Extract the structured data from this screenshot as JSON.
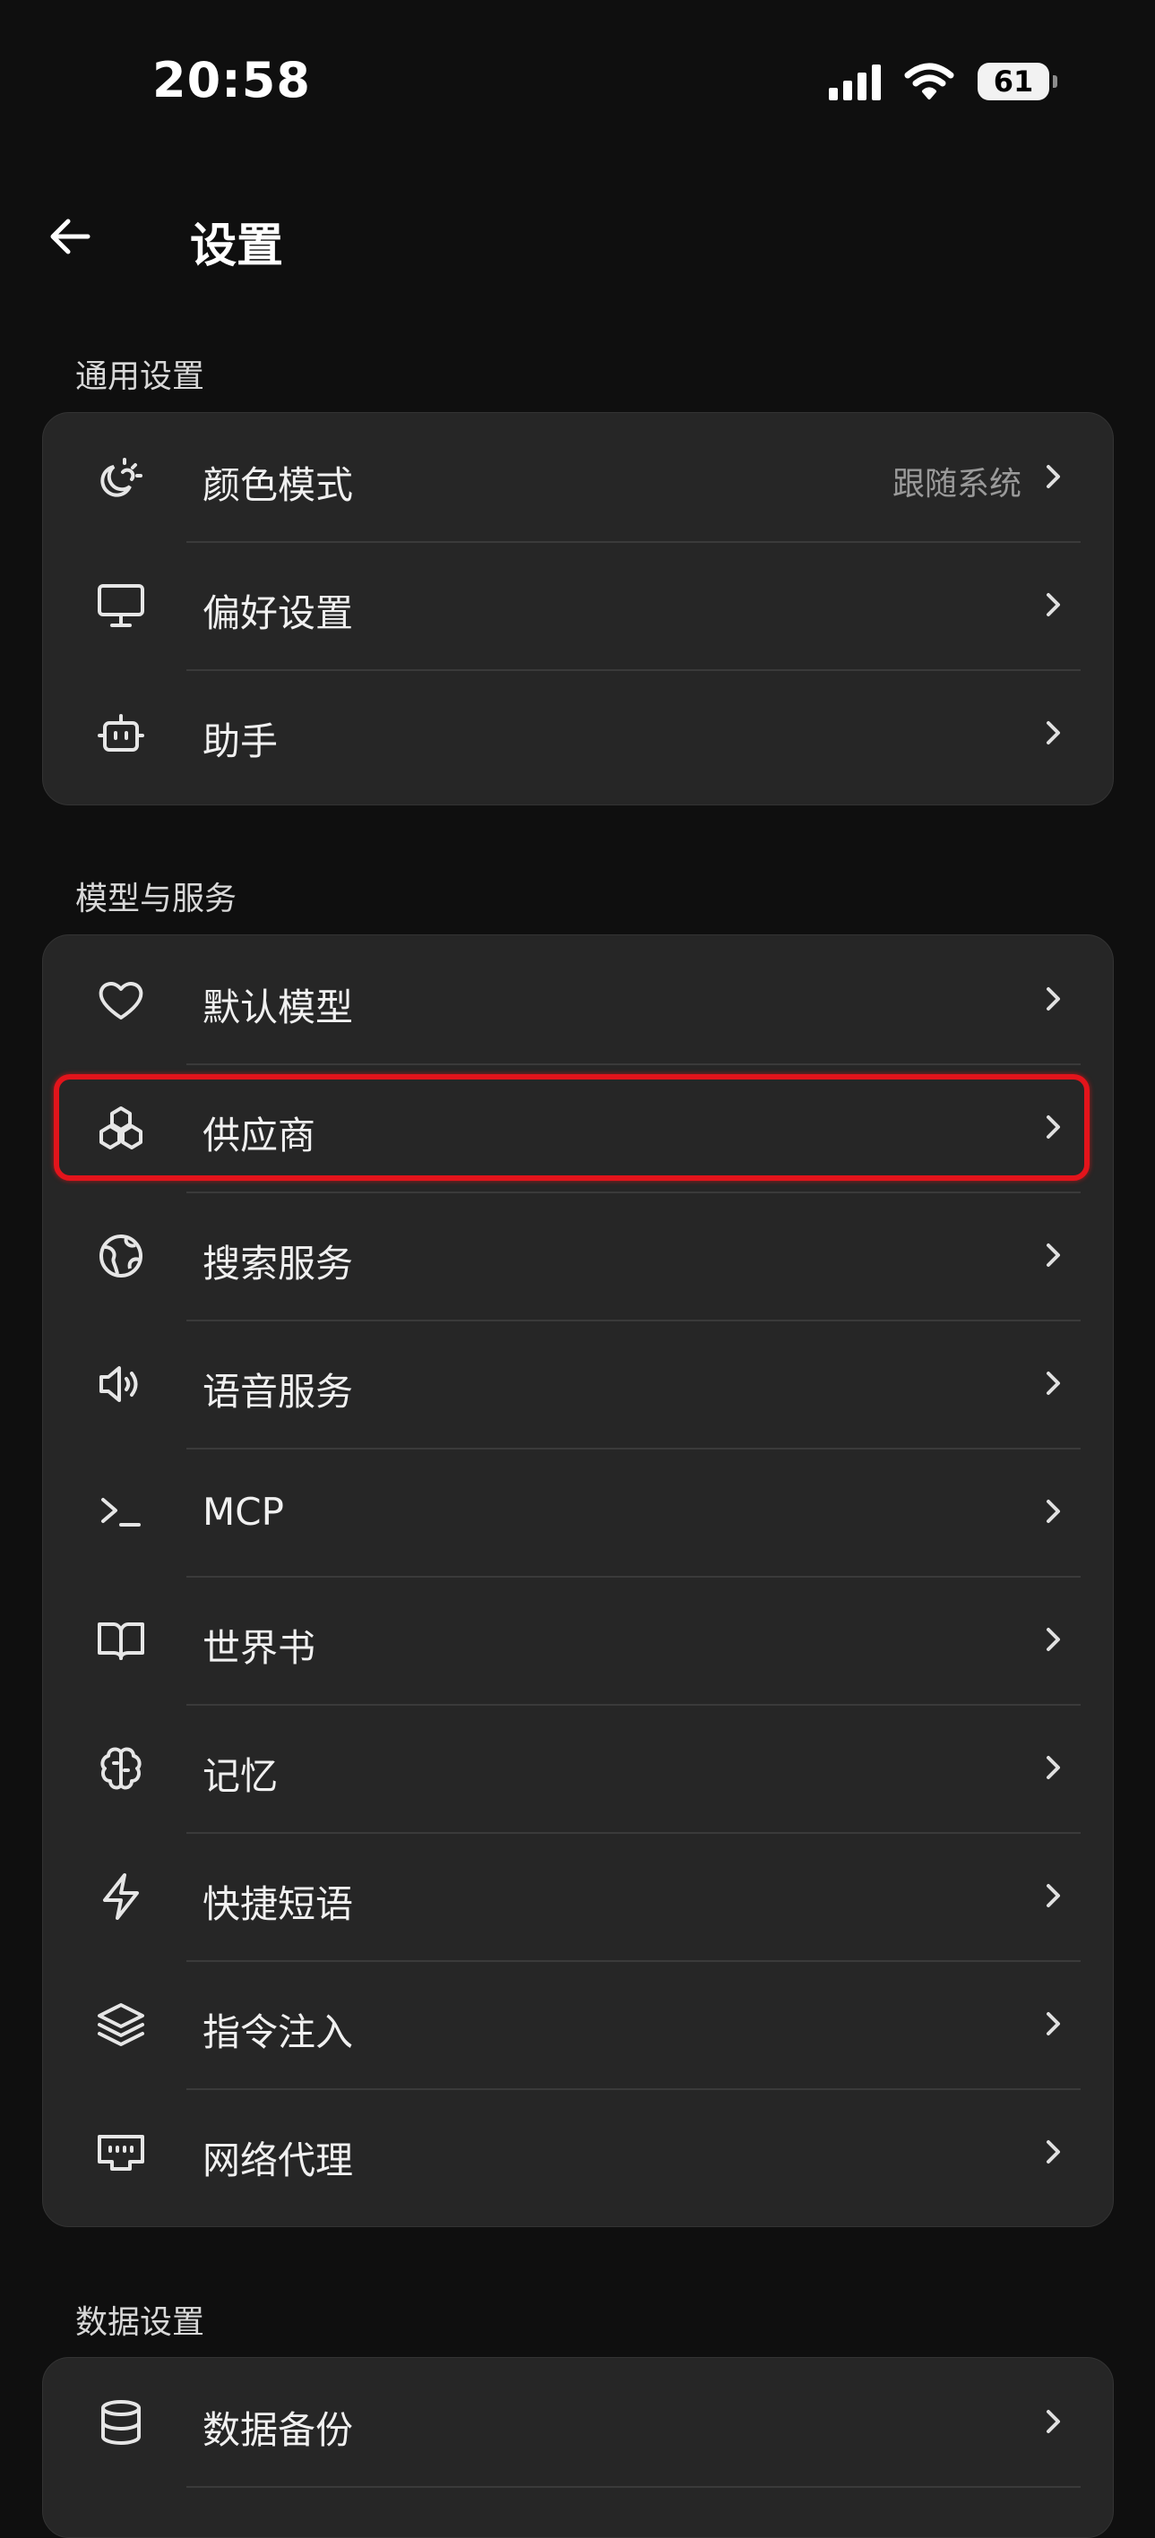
{
  "status_bar": {
    "time": "20:58",
    "battery": "61"
  },
  "header": {
    "title": "设置"
  },
  "sections": {
    "general": {
      "label": "通用设置",
      "items": [
        {
          "label": "颜色模式",
          "value": "跟随系统",
          "icon": "theme-icon"
        },
        {
          "label": "偏好设置",
          "icon": "monitor-icon"
        },
        {
          "label": "助手",
          "icon": "bot-icon"
        }
      ]
    },
    "models": {
      "label": "模型与服务",
      "items": [
        {
          "label": "默认模型",
          "icon": "heart-icon"
        },
        {
          "label": "供应商",
          "icon": "boxes-icon",
          "highlighted": true
        },
        {
          "label": "搜索服务",
          "icon": "globe-icon"
        },
        {
          "label": "语音服务",
          "icon": "speaker-icon"
        },
        {
          "label": "MCP",
          "icon": "terminal-icon"
        },
        {
          "label": "世界书",
          "icon": "book-icon"
        },
        {
          "label": "记忆",
          "icon": "brain-icon"
        },
        {
          "label": "快捷短语",
          "icon": "zap-icon"
        },
        {
          "label": "指令注入",
          "icon": "layers-icon"
        },
        {
          "label": "网络代理",
          "icon": "ethernet-icon"
        }
      ]
    },
    "data": {
      "label": "数据设置",
      "items": [
        {
          "label": "数据备份",
          "icon": "database-icon"
        }
      ]
    }
  }
}
